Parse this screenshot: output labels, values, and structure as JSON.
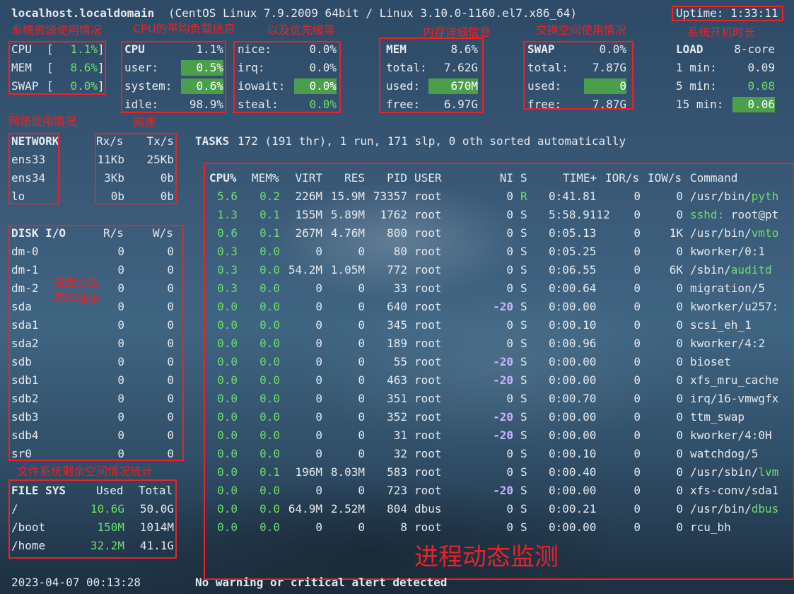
{
  "header": {
    "hostname": "localhost.localdomain",
    "system": "(CentOS Linux 7.9.2009 64bit / Linux 3.10.0-1160.el7.x86_64)",
    "uptime": "Uptime: 1:33:11"
  },
  "annotations": {
    "sys_resources": "系统资源使用情况",
    "cpu_load": "CPU的平均负载信息",
    "priority": "以及优先级等",
    "mem_detail": "内存详细信息",
    "swap_usage": "交换空间使用情况",
    "uptime_label": "系统开机时长",
    "network_usage": "网络使用情况",
    "net_speed": "网速",
    "disk_io_line1": "磁盘分区",
    "disk_io_line2": "的IO速率",
    "fs_stats": "文件系统剩余空间情况统计",
    "process_monitor": "进程动态监测"
  },
  "quicklook": {
    "cpu": {
      "label": "CPU",
      "value": "1.1%"
    },
    "mem": {
      "label": "MEM",
      "value": "8.6%"
    },
    "swap": {
      "label": "SWAP",
      "value": "0.0%"
    }
  },
  "cpu": {
    "header": "CPU",
    "total": "1.1%",
    "user_label": "user:",
    "user": "0.5%",
    "system_label": "system:",
    "system": "0.6%",
    "idle_label": "idle:",
    "idle": "98.9%"
  },
  "cpu2": {
    "nice_label": "nice:",
    "nice": "0.0%",
    "irq_label": "irq:",
    "irq": "0.0%",
    "iowait_label": "iowait:",
    "iowait": "0.0%",
    "steal_label": "steal:",
    "steal": "0.0%"
  },
  "mem": {
    "header": "MEM",
    "percent": "8.6%",
    "total_label": "total:",
    "total": "7.62G",
    "used_label": "used:",
    "used": "670M",
    "free_label": "free:",
    "free": "6.97G"
  },
  "swap": {
    "header": "SWAP",
    "percent": "0.0%",
    "total_label": "total:",
    "total": "7.87G",
    "used_label": "used:",
    "used": "0",
    "free_label": "free:",
    "free": "7.87G"
  },
  "load": {
    "header": "LOAD",
    "cores": "8-core",
    "m1_label": "1 min:",
    "m1": "0.09",
    "m5_label": "5 min:",
    "m5": "0.08",
    "m15_label": "15 min:",
    "m15": "0.06"
  },
  "network": {
    "header": "NETWORK",
    "rx": "Rx/s",
    "tx": "Tx/s",
    "rows": [
      {
        "name": "ens33",
        "rx": "11Kb",
        "tx": "25Kb"
      },
      {
        "name": "ens34",
        "rx": "3Kb",
        "tx": "0b"
      },
      {
        "name": "lo",
        "rx": "0b",
        "tx": "0b"
      }
    ]
  },
  "tasks": {
    "label": "TASKS",
    "summary": "172 (191 thr), 1 run, 171 slp, 0 oth sorted automatically"
  },
  "diskio": {
    "header": "DISK I/O",
    "r": "R/s",
    "w": "W/s",
    "rows": [
      {
        "name": "dm-0",
        "r": "0",
        "w": "0"
      },
      {
        "name": "dm-1",
        "r": "0",
        "w": "0"
      },
      {
        "name": "dm-2",
        "r": "0",
        "w": "0"
      },
      {
        "name": "sda",
        "r": "0",
        "w": "0"
      },
      {
        "name": "sda1",
        "r": "0",
        "w": "0"
      },
      {
        "name": "sda2",
        "r": "0",
        "w": "0"
      },
      {
        "name": "sdb",
        "r": "0",
        "w": "0"
      },
      {
        "name": "sdb1",
        "r": "0",
        "w": "0"
      },
      {
        "name": "sdb2",
        "r": "0",
        "w": "0"
      },
      {
        "name": "sdb3",
        "r": "0",
        "w": "0"
      },
      {
        "name": "sdb4",
        "r": "0",
        "w": "0"
      },
      {
        "name": "sr0",
        "r": "0",
        "w": "0"
      }
    ]
  },
  "fs": {
    "header": "FILE SYS",
    "used": "Used",
    "total": "Total",
    "rows": [
      {
        "name": "/",
        "used": "10.6G",
        "total": "50.0G"
      },
      {
        "name": "/boot",
        "used": "150M",
        "total": "1014M"
      },
      {
        "name": "/home",
        "used": "32.2M",
        "total": "41.1G"
      }
    ]
  },
  "proc": {
    "headers": {
      "cpu": "CPU%",
      "mem": "MEM%",
      "virt": "VIRT",
      "res": "RES",
      "pid": "PID",
      "user": "USER",
      "ni": "NI",
      "s": "S",
      "time": "TIME+",
      "ior": "IOR/s",
      "iow": "IOW/s",
      "cmd": "Command"
    },
    "rows": [
      {
        "cpu": "5.6",
        "mem": "0.2",
        "virt": "226M",
        "res": "15.9M",
        "pid": "73357",
        "user": "root",
        "ni": "0",
        "s": "R",
        "time": "0:41.81",
        "ior": "0",
        "iow": "0",
        "cmd": "/usr/bin/",
        "cmd_hl": "pyth",
        "ni_neg": false
      },
      {
        "cpu": "1.3",
        "mem": "0.1",
        "virt": "155M",
        "res": "5.89M",
        "pid": "1762",
        "user": "root",
        "ni": "0",
        "s": "S",
        "time": "5:58.9112",
        "ior": "0",
        "iow": "0",
        "cmd": "",
        "cmd_hl": "sshd:",
        "cmd_tail": " root@pt",
        "ni_neg": false
      },
      {
        "cpu": "0.6",
        "mem": "0.1",
        "virt": "267M",
        "res": "4.76M",
        "pid": "800",
        "user": "root",
        "ni": "0",
        "s": "S",
        "time": "0:05.13",
        "ior": "0",
        "iow": "1K",
        "cmd": "/usr/bin/",
        "cmd_hl": "vmto",
        "ni_neg": false
      },
      {
        "cpu": "0.3",
        "mem": "0.0",
        "virt": "0",
        "res": "0",
        "pid": "80",
        "user": "root",
        "ni": "0",
        "s": "S",
        "time": "0:05.25",
        "ior": "0",
        "iow": "0",
        "cmd": "kworker/0:1",
        "ni_neg": false
      },
      {
        "cpu": "0.3",
        "mem": "0.0",
        "virt": "54.2M",
        "res": "1.05M",
        "pid": "772",
        "user": "root",
        "ni": "0",
        "s": "S",
        "time": "0:06.55",
        "ior": "0",
        "iow": "6K",
        "cmd": "/sbin/",
        "cmd_hl": "auditd",
        "ni_neg": false
      },
      {
        "cpu": "0.3",
        "mem": "0.0",
        "virt": "0",
        "res": "0",
        "pid": "33",
        "user": "root",
        "ni": "0",
        "s": "S",
        "time": "0:00.64",
        "ior": "0",
        "iow": "0",
        "cmd": "migration/5",
        "ni_neg": false
      },
      {
        "cpu": "0.0",
        "mem": "0.0",
        "virt": "0",
        "res": "0",
        "pid": "640",
        "user": "root",
        "ni": "-20",
        "s": "S",
        "time": "0:00.00",
        "ior": "0",
        "iow": "0",
        "cmd": "kworker/u257:",
        "ni_neg": true
      },
      {
        "cpu": "0.0",
        "mem": "0.0",
        "virt": "0",
        "res": "0",
        "pid": "345",
        "user": "root",
        "ni": "0",
        "s": "S",
        "time": "0:00.10",
        "ior": "0",
        "iow": "0",
        "cmd": "scsi_eh_1",
        "ni_neg": false
      },
      {
        "cpu": "0.0",
        "mem": "0.0",
        "virt": "0",
        "res": "0",
        "pid": "189",
        "user": "root",
        "ni": "0",
        "s": "S",
        "time": "0:00.96",
        "ior": "0",
        "iow": "0",
        "cmd": "kworker/4:2",
        "ni_neg": false
      },
      {
        "cpu": "0.0",
        "mem": "0.0",
        "virt": "0",
        "res": "0",
        "pid": "55",
        "user": "root",
        "ni": "-20",
        "s": "S",
        "time": "0:00.00",
        "ior": "0",
        "iow": "0",
        "cmd": "bioset",
        "ni_neg": true
      },
      {
        "cpu": "0.0",
        "mem": "0.0",
        "virt": "0",
        "res": "0",
        "pid": "463",
        "user": "root",
        "ni": "-20",
        "s": "S",
        "time": "0:00.00",
        "ior": "0",
        "iow": "0",
        "cmd": "xfs_mru_cache",
        "ni_neg": true
      },
      {
        "cpu": "0.0",
        "mem": "0.0",
        "virt": "0",
        "res": "0",
        "pid": "351",
        "user": "root",
        "ni": "0",
        "s": "S",
        "time": "0:00.70",
        "ior": "0",
        "iow": "0",
        "cmd": "irq/16-vmwgfx",
        "ni_neg": false
      },
      {
        "cpu": "0.0",
        "mem": "0.0",
        "virt": "0",
        "res": "0",
        "pid": "352",
        "user": "root",
        "ni": "-20",
        "s": "S",
        "time": "0:00.00",
        "ior": "0",
        "iow": "0",
        "cmd": "ttm_swap",
        "ni_neg": true
      },
      {
        "cpu": "0.0",
        "mem": "0.0",
        "virt": "0",
        "res": "0",
        "pid": "31",
        "user": "root",
        "ni": "-20",
        "s": "S",
        "time": "0:00.00",
        "ior": "0",
        "iow": "0",
        "cmd": "kworker/4:0H",
        "ni_neg": true
      },
      {
        "cpu": "0.0",
        "mem": "0.0",
        "virt": "0",
        "res": "0",
        "pid": "32",
        "user": "root",
        "ni": "0",
        "s": "S",
        "time": "0:00.10",
        "ior": "0",
        "iow": "0",
        "cmd": "watchdog/5",
        "ni_neg": false
      },
      {
        "cpu": "0.0",
        "mem": "0.1",
        "virt": "196M",
        "res": "8.03M",
        "pid": "583",
        "user": "root",
        "ni": "0",
        "s": "S",
        "time": "0:00.40",
        "ior": "0",
        "iow": "0",
        "cmd": "/usr/sbin/",
        "cmd_hl": "lvm",
        "ni_neg": false
      },
      {
        "cpu": "0.0",
        "mem": "0.0",
        "virt": "0",
        "res": "0",
        "pid": "723",
        "user": "root",
        "ni": "-20",
        "s": "S",
        "time": "0:00.00",
        "ior": "0",
        "iow": "0",
        "cmd": "xfs-conv/sda1",
        "ni_neg": true
      },
      {
        "cpu": "0.0",
        "mem": "0.0",
        "virt": "64.9M",
        "res": "2.52M",
        "pid": "804",
        "user": "dbus",
        "ni": "0",
        "s": "S",
        "time": "0:00.21",
        "ior": "0",
        "iow": "0",
        "cmd": "/usr/bin/",
        "cmd_hl": "dbus",
        "ni_neg": false
      },
      {
        "cpu": "0.0",
        "mem": "0.0",
        "virt": "0",
        "res": "0",
        "pid": "8",
        "user": "root",
        "ni": "0",
        "s": "S",
        "time": "0:00.00",
        "ior": "0",
        "iow": "0",
        "cmd": "rcu_bh",
        "ni_neg": false
      }
    ]
  },
  "footer": {
    "datetime": "2023-04-07 00:13:28",
    "alert": "No warning or critical alert detected"
  },
  "colors": {
    "ok": "#6fdc6f",
    "highlight": "#4b9f4a",
    "annotation": "#e8232a",
    "nice_neg": "#c9b3ff"
  }
}
